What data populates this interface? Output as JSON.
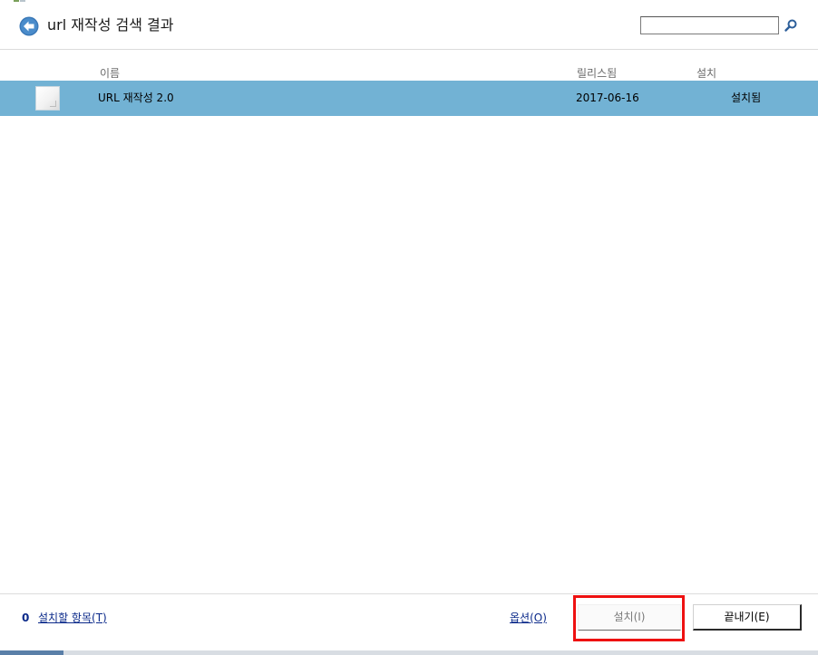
{
  "header": {
    "title": "url 재작성 검색 결과",
    "search_placeholder": "",
    "search_value": ""
  },
  "columns": {
    "name": "이름",
    "released": "릴리스됨",
    "install": "설치"
  },
  "results": [
    {
      "name": "URL 재작성 2.0",
      "released": "2017-06-16",
      "status": "설치됨",
      "selected": true
    }
  ],
  "footer": {
    "count": "0",
    "items_link": "설치할 항목(T)",
    "options_link": "옵션(O)",
    "install_button": "설치(I)",
    "exit_button": "끝내기(E)"
  },
  "icons": {
    "back": "back-arrow-icon",
    "search": "search-icon",
    "row_thumbnail": "package-icon",
    "corner": "app-icon"
  },
  "colors": {
    "selected_row": "#72b2d4",
    "link": "#0b2a8a",
    "highlight": "#ee1111",
    "back_button": "#3a78b7"
  }
}
